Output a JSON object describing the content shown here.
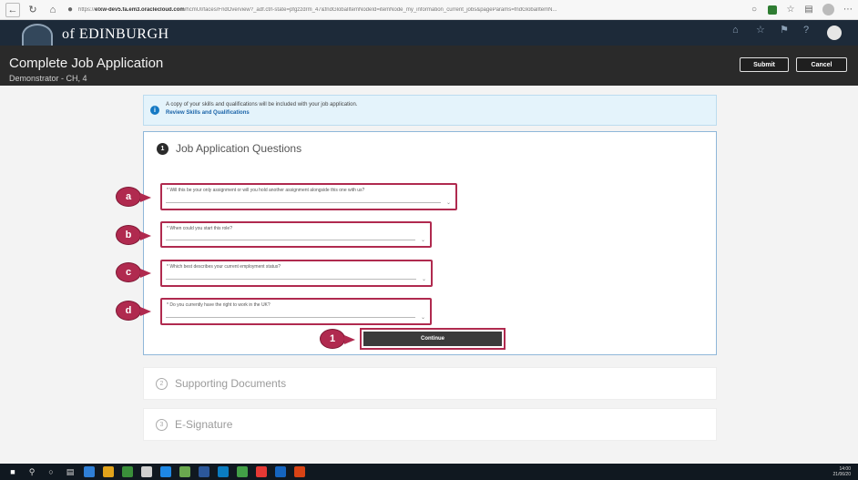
{
  "browser": {
    "url_prefix": "https://",
    "url_host": "elxw-dev5.fa.em3.oraclecloud.com",
    "url_rest": "/hcmUI/faces/FndOverview?_adf.ctrl-state=pfgzzdrm_47&fndGlobalItemNodeId=itemNode_my_information_current_jobs&pageParams=fndGlobalItemN..."
  },
  "brand": {
    "text": "of EDINBURGH"
  },
  "page": {
    "title": "Complete Job Application",
    "subtitle": "Demonstrator - CH, 4",
    "submit_label": "Submit",
    "cancel_label": "Cancel"
  },
  "info": {
    "message": "A copy of your skills and qualifications will be included with your job application.",
    "link": "Review Skills and Qualifications"
  },
  "questions": {
    "step_number": "1",
    "title": "Job Application Questions",
    "fields": [
      {
        "label": "* Will this be your only assignment or will you hold another assignment alongside this one with us?"
      },
      {
        "label": "* When could you start this role?"
      },
      {
        "label": "* Which best describes your current employment status?"
      },
      {
        "label": "* Do you currently have the right to work in the UK?"
      }
    ],
    "continue_label": "Continue"
  },
  "markers": [
    "a",
    "b",
    "c",
    "d",
    "1"
  ],
  "sections": [
    {
      "number": "2",
      "title": "Supporting Documents"
    },
    {
      "number": "3",
      "title": "E-Signature"
    }
  ],
  "taskbar": {
    "time": "14:00",
    "date": "21/06/20"
  },
  "colors": {
    "header_bg": "#1d2a39",
    "title_bar_bg": "#2a2a2a",
    "annotation": "#b02a4f",
    "info_bg": "#e4f3fb"
  }
}
